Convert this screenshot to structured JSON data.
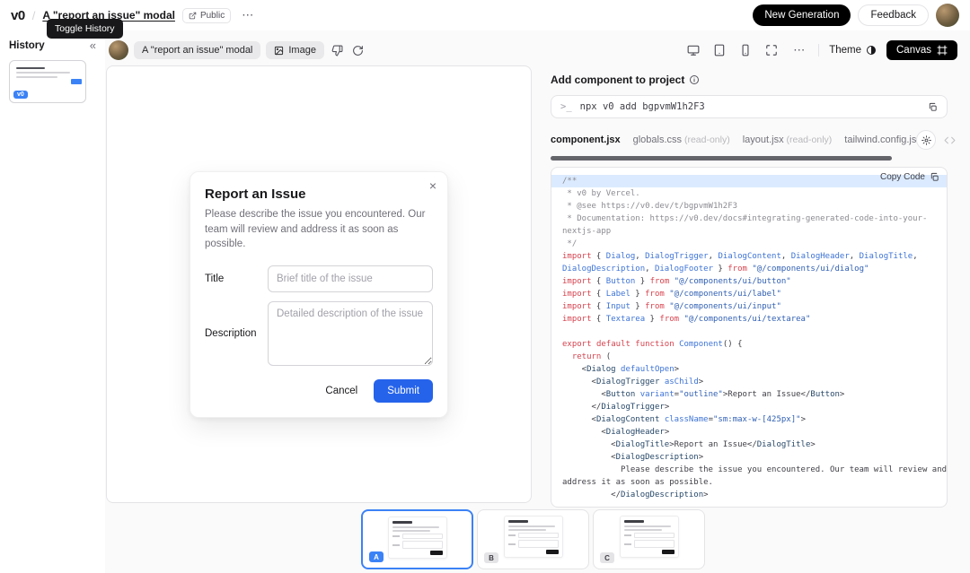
{
  "header": {
    "logo_text": "v0",
    "separator": "/",
    "title": "A \"report an issue\" modal",
    "public_label": "Public",
    "more_icon": "⋯",
    "new_generation_label": "New Generation",
    "feedback_label": "Feedback",
    "tooltip": "Toggle History"
  },
  "sidebar": {
    "title": "History",
    "collapse_icon": "«",
    "version_badge": "v0"
  },
  "toolbar": {
    "chat_chip": "A \"report an issue\" modal",
    "image_chip": "Image",
    "more_icon": "⋯",
    "theme_label": "Theme",
    "canvas_label": "Canvas"
  },
  "preview": {
    "modal": {
      "close_icon": "×",
      "title": "Report an Issue",
      "description": "Please describe the issue you encountered. Our team will review and address it as soon as possible.",
      "title_label": "Title",
      "title_placeholder": "Brief title of the issue",
      "description_label": "Description",
      "description_placeholder": "Detailed description of the issue",
      "cancel_label": "Cancel",
      "submit_label": "Submit"
    }
  },
  "panel": {
    "heading": "Add component to project",
    "prompt": ">_",
    "command": "npx v0 add bgpvmW1h2F3",
    "copy_code_label": "Copy Code",
    "highlighted_line": 0,
    "tabs": [
      {
        "label": "component.jsx",
        "suffix": "",
        "active": true
      },
      {
        "label": "globals.css",
        "suffix": "(read-only)",
        "active": false
      },
      {
        "label": "layout.jsx",
        "suffix": "(read-only)",
        "active": false
      },
      {
        "label": "tailwind.config.js",
        "suffix": "",
        "active": false
      }
    ],
    "code_lines": [
      [
        {
          "c": "com",
          "t": "/**"
        }
      ],
      [
        {
          "c": "com",
          "t": " * v0 by Vercel."
        }
      ],
      [
        {
          "c": "com",
          "t": " * @see https://v0.dev/t/bgpvmW1h2F3"
        }
      ],
      [
        {
          "c": "com",
          "t": " * Documentation: https://v0.dev/docs#integrating-generated-code-into-your-"
        }
      ],
      [
        {
          "c": "com",
          "t": "nextjs-app"
        }
      ],
      [
        {
          "c": "com",
          "t": " */"
        }
      ],
      [
        {
          "c": "kw",
          "t": "import"
        },
        {
          "c": "pln",
          "t": " { "
        },
        {
          "c": "id",
          "t": "Dialog"
        },
        {
          "c": "pln",
          "t": ", "
        },
        {
          "c": "id",
          "t": "DialogTrigger"
        },
        {
          "c": "pln",
          "t": ", "
        },
        {
          "c": "id",
          "t": "DialogContent"
        },
        {
          "c": "pln",
          "t": ", "
        },
        {
          "c": "id",
          "t": "DialogHeader"
        },
        {
          "c": "pln",
          "t": ", "
        },
        {
          "c": "id",
          "t": "DialogTitle"
        },
        {
          "c": "pln",
          "t": ","
        }
      ],
      [
        {
          "c": "id",
          "t": "DialogDescription"
        },
        {
          "c": "pln",
          "t": ", "
        },
        {
          "c": "id",
          "t": "DialogFooter"
        },
        {
          "c": "pln",
          "t": " } "
        },
        {
          "c": "kw",
          "t": "from"
        },
        {
          "c": "pln",
          "t": " "
        },
        {
          "c": "str",
          "t": "\"@/components/ui/dialog\""
        }
      ],
      [
        {
          "c": "kw",
          "t": "import"
        },
        {
          "c": "pln",
          "t": " { "
        },
        {
          "c": "id",
          "t": "Button"
        },
        {
          "c": "pln",
          "t": " } "
        },
        {
          "c": "kw",
          "t": "from"
        },
        {
          "c": "pln",
          "t": " "
        },
        {
          "c": "str",
          "t": "\"@/components/ui/button\""
        }
      ],
      [
        {
          "c": "kw",
          "t": "import"
        },
        {
          "c": "pln",
          "t": " { "
        },
        {
          "c": "id",
          "t": "Label"
        },
        {
          "c": "pln",
          "t": " } "
        },
        {
          "c": "kw",
          "t": "from"
        },
        {
          "c": "pln",
          "t": " "
        },
        {
          "c": "str",
          "t": "\"@/components/ui/label\""
        }
      ],
      [
        {
          "c": "kw",
          "t": "import"
        },
        {
          "c": "pln",
          "t": " { "
        },
        {
          "c": "id",
          "t": "Input"
        },
        {
          "c": "pln",
          "t": " } "
        },
        {
          "c": "kw",
          "t": "from"
        },
        {
          "c": "pln",
          "t": " "
        },
        {
          "c": "str",
          "t": "\"@/components/ui/input\""
        }
      ],
      [
        {
          "c": "kw",
          "t": "import"
        },
        {
          "c": "pln",
          "t": " { "
        },
        {
          "c": "id",
          "t": "Textarea"
        },
        {
          "c": "pln",
          "t": " } "
        },
        {
          "c": "kw",
          "t": "from"
        },
        {
          "c": "pln",
          "t": " "
        },
        {
          "c": "str",
          "t": "\"@/components/ui/textarea\""
        }
      ],
      [],
      [
        {
          "c": "kw",
          "t": "export"
        },
        {
          "c": "pln",
          "t": " "
        },
        {
          "c": "kw",
          "t": "default"
        },
        {
          "c": "pln",
          "t": " "
        },
        {
          "c": "kw",
          "t": "function"
        },
        {
          "c": "pln",
          "t": " "
        },
        {
          "c": "id",
          "t": "Component"
        },
        {
          "c": "pln",
          "t": "() {"
        }
      ],
      [
        {
          "c": "pln",
          "t": "  "
        },
        {
          "c": "kw",
          "t": "return"
        },
        {
          "c": "pln",
          "t": " ("
        }
      ],
      [
        {
          "c": "pln",
          "t": "    <"
        },
        {
          "c": "tag",
          "t": "Dialog"
        },
        {
          "c": "pln",
          "t": " "
        },
        {
          "c": "attr",
          "t": "defaultOpen"
        },
        {
          "c": "pln",
          "t": ">"
        }
      ],
      [
        {
          "c": "pln",
          "t": "      <"
        },
        {
          "c": "tag",
          "t": "DialogTrigger"
        },
        {
          "c": "pln",
          "t": " "
        },
        {
          "c": "attr",
          "t": "asChild"
        },
        {
          "c": "pln",
          "t": ">"
        }
      ],
      [
        {
          "c": "pln",
          "t": "        <"
        },
        {
          "c": "tag",
          "t": "Button"
        },
        {
          "c": "pln",
          "t": " "
        },
        {
          "c": "attr",
          "t": "variant"
        },
        {
          "c": "pln",
          "t": "="
        },
        {
          "c": "str",
          "t": "\"outline\""
        },
        {
          "c": "pln",
          "t": ">Report an Issue</"
        },
        {
          "c": "tag",
          "t": "Button"
        },
        {
          "c": "pln",
          "t": ">"
        }
      ],
      [
        {
          "c": "pln",
          "t": "      </"
        },
        {
          "c": "tag",
          "t": "DialogTrigger"
        },
        {
          "c": "pln",
          "t": ">"
        }
      ],
      [
        {
          "c": "pln",
          "t": "      <"
        },
        {
          "c": "tag",
          "t": "DialogContent"
        },
        {
          "c": "pln",
          "t": " "
        },
        {
          "c": "attr",
          "t": "className"
        },
        {
          "c": "pln",
          "t": "="
        },
        {
          "c": "str",
          "t": "\"sm:max-w-[425px]\""
        },
        {
          "c": "pln",
          "t": ">"
        }
      ],
      [
        {
          "c": "pln",
          "t": "        <"
        },
        {
          "c": "tag",
          "t": "DialogHeader"
        },
        {
          "c": "pln",
          "t": ">"
        }
      ],
      [
        {
          "c": "pln",
          "t": "          <"
        },
        {
          "c": "tag",
          "t": "DialogTitle"
        },
        {
          "c": "pln",
          "t": ">Report an Issue</"
        },
        {
          "c": "tag",
          "t": "DialogTitle"
        },
        {
          "c": "pln",
          "t": ">"
        }
      ],
      [
        {
          "c": "pln",
          "t": "          <"
        },
        {
          "c": "tag",
          "t": "DialogDescription"
        },
        {
          "c": "pln",
          "t": ">"
        }
      ],
      [
        {
          "c": "pln",
          "t": "            Please describe the issue you encountered. Our team will review and"
        }
      ],
      [
        {
          "c": "pln",
          "t": "address it as soon as possible."
        }
      ],
      [
        {
          "c": "pln",
          "t": "          </"
        },
        {
          "c": "tag",
          "t": "DialogDescription"
        },
        {
          "c": "pln",
          "t": ">"
        }
      ]
    ]
  },
  "variants": [
    {
      "label": "A",
      "selected": true
    },
    {
      "label": "B",
      "selected": false
    },
    {
      "label": "C",
      "selected": false
    }
  ],
  "colors": {
    "accent_blue": "#2563eb",
    "selected_variant_blue": "#3b82f6",
    "button_black": "#000000",
    "highlighted_code_line": "#dbeafe",
    "workspace_background": "#fafafa"
  }
}
